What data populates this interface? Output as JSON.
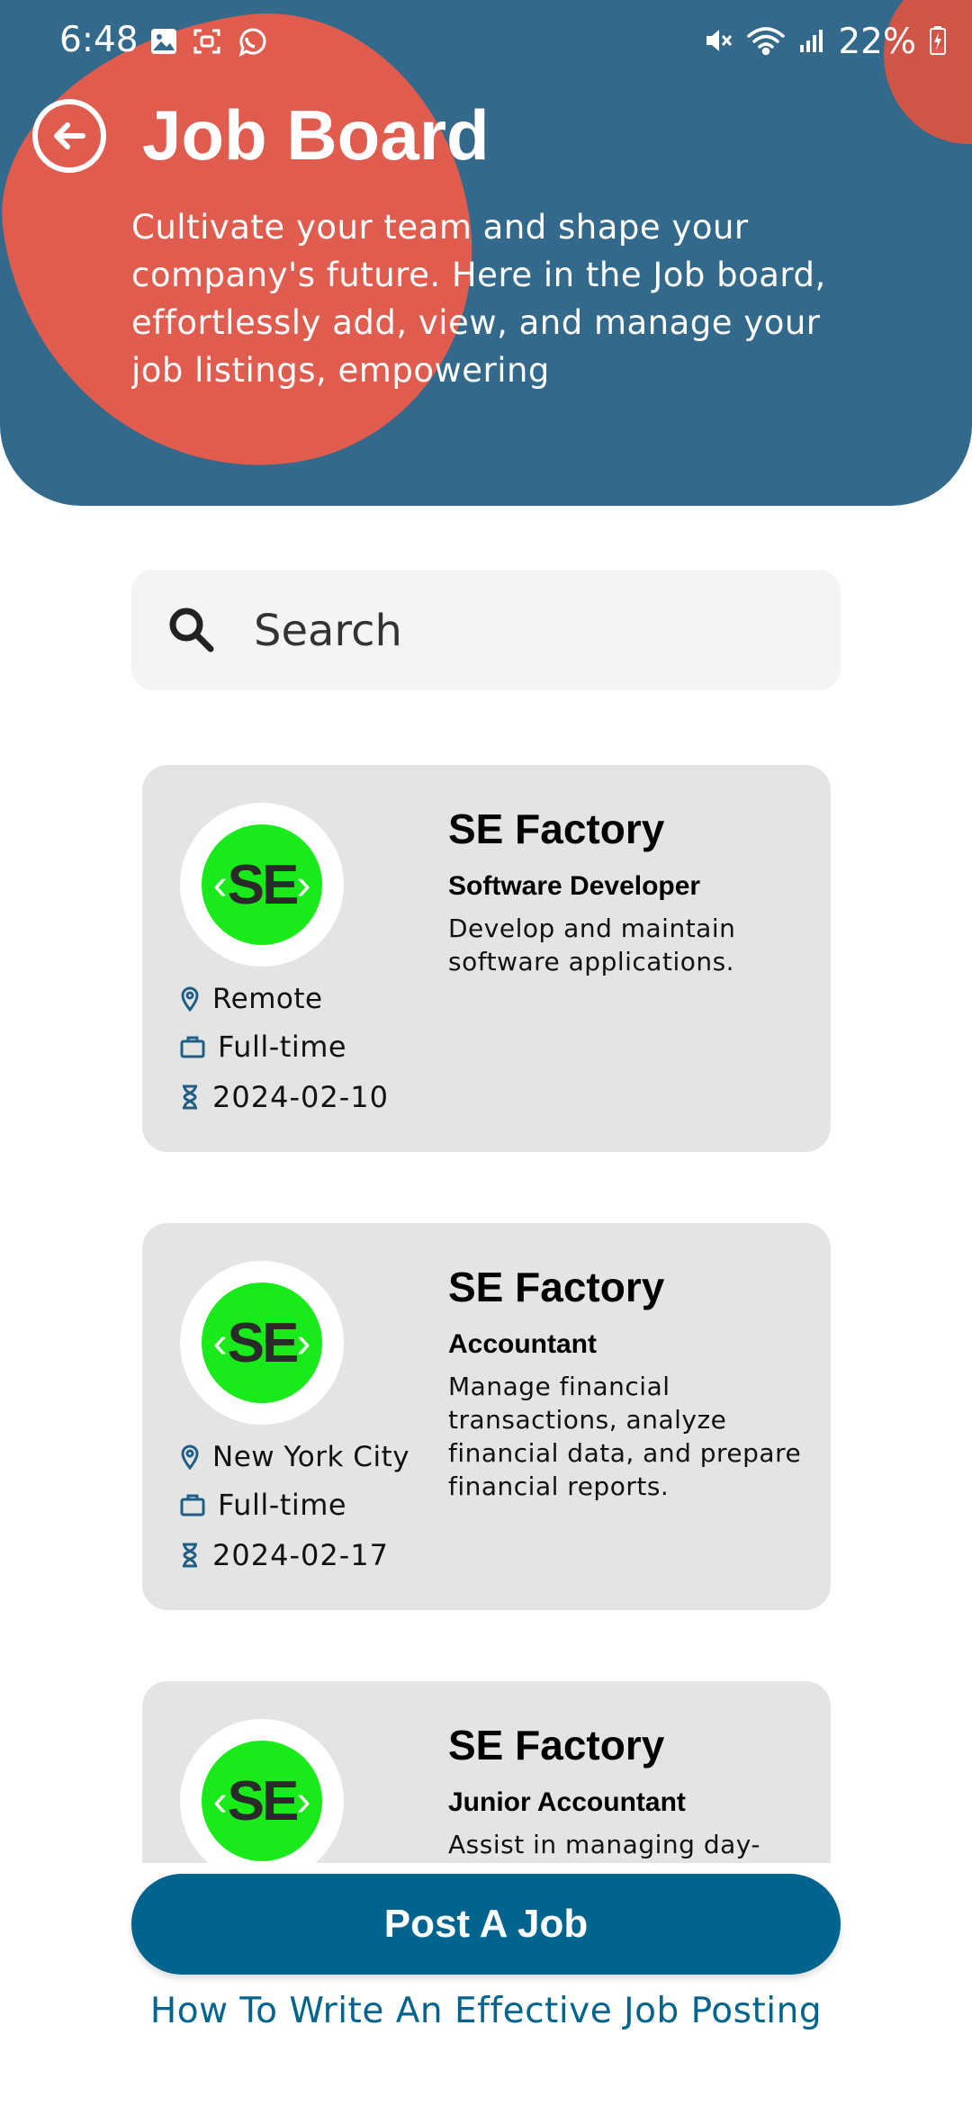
{
  "status_bar": {
    "time": "6:48",
    "battery": "22%"
  },
  "header": {
    "title": "Job Board",
    "subtitle": "Cultivate your team and shape your company's future. Here in the Job board, effortlessly add, view, and manage your job listings, empowering"
  },
  "search": {
    "placeholder": "Search"
  },
  "jobs": [
    {
      "company": "SE Factory",
      "logo_text": "SE",
      "title": "Software Developer",
      "description": "Develop and maintain software applications.",
      "location": "Remote",
      "type": "Full-time",
      "date": "2024-02-10"
    },
    {
      "company": "SE Factory",
      "logo_text": "SE",
      "title": "Accountant",
      "description": "Manage financial transactions, analyze financial data, and prepare financial reports.",
      "location": "New York City",
      "type": "Full-time",
      "date": "2024-02-17"
    },
    {
      "company": "SE Factory",
      "logo_text": "SE",
      "title": "Junior Accountant",
      "description": "Assist in managing day-",
      "location": "",
      "type": "",
      "date": ""
    }
  ],
  "actions": {
    "post_job": "Post A Job",
    "help_link": "How To Write An Effective Job Posting"
  },
  "colors": {
    "header_bg": "#33698a",
    "blob": "#e05c4f",
    "primary": "#00648f",
    "logo_green": "#19ea19",
    "card_bg": "#e4e4e4"
  }
}
